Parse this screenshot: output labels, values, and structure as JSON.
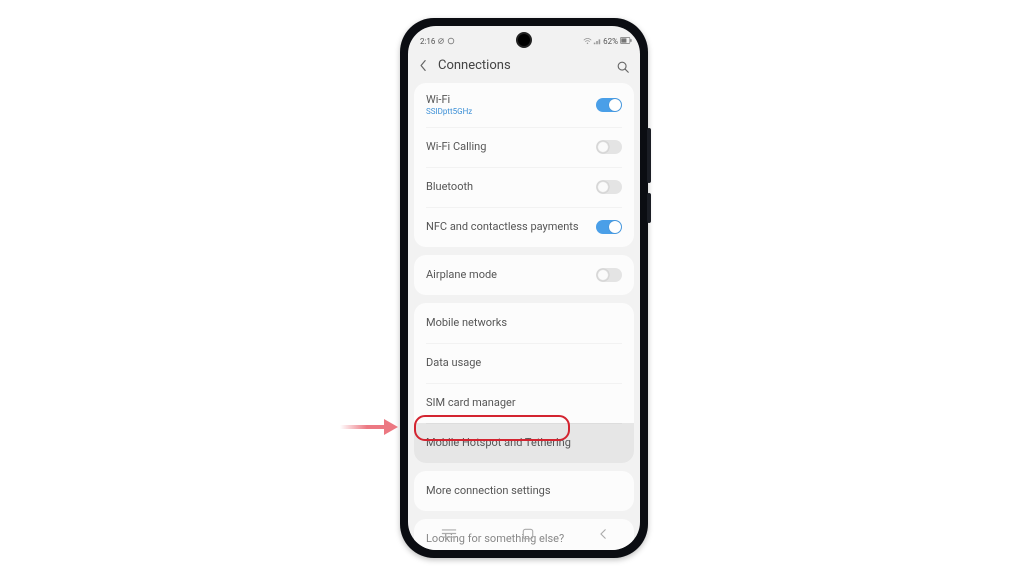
{
  "status": {
    "time": "2:16",
    "battery_text": "62%"
  },
  "header": {
    "title": "Connections"
  },
  "groups": [
    {
      "rows": [
        {
          "key": "wifi",
          "label": "Wi-Fi",
          "sub": "SSIDptt5GHz",
          "toggle": "on"
        },
        {
          "key": "wifi-calling",
          "label": "Wi-Fi Calling",
          "toggle": "off"
        },
        {
          "key": "bluetooth",
          "label": "Bluetooth",
          "toggle": "off"
        },
        {
          "key": "nfc",
          "label": "NFC and contactless payments",
          "toggle": "on"
        }
      ]
    },
    {
      "rows": [
        {
          "key": "airplane",
          "label": "Airplane mode",
          "toggle": "off"
        }
      ]
    },
    {
      "rows": [
        {
          "key": "mobile-networks",
          "label": "Mobile networks"
        },
        {
          "key": "data-usage",
          "label": "Data usage"
        },
        {
          "key": "sim-card",
          "label": "SIM card manager"
        },
        {
          "key": "hotspot",
          "label": "Mobile Hotspot and Tethering",
          "highlighted": true
        }
      ]
    },
    {
      "rows": [
        {
          "key": "more",
          "label": "More connection settings"
        }
      ]
    },
    {
      "footer": true,
      "rows": [
        {
          "key": "looking",
          "label": "Looking for something else?"
        }
      ]
    }
  ]
}
